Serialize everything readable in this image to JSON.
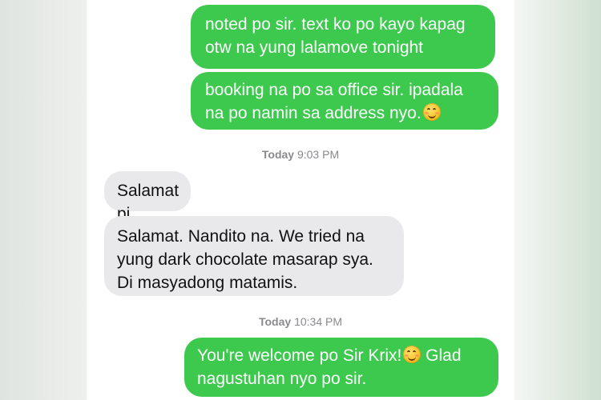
{
  "conversation": {
    "messages": [
      {
        "direction": "sent",
        "text": "noted po sir. text ko po kayo kapag\notw na yung lalamove tonight"
      },
      {
        "direction": "sent",
        "text": "booking na po sa office sir. ipadala\nna po namin sa address nyo.",
        "emoji": "smiling-face-icon"
      },
      {
        "direction": "received",
        "text": "Salamat pi"
      },
      {
        "direction": "received",
        "text": "Salamat. Nandito na. We tried na\nyung dark chocolate masarap sya.\nDi masyadong matamis."
      },
      {
        "direction": "sent",
        "text_before_emoji": "You're welcome po Sir Krix!",
        "emoji": "smiling-face-icon",
        "text_after_emoji": " Glad\nnagustuhan nyo po sir."
      }
    ],
    "timestamps": [
      {
        "day": "Today",
        "time": "9:03 PM"
      },
      {
        "day": "Today",
        "time": "10:34 PM"
      }
    ]
  },
  "colors": {
    "sent_bubble": "#3cc94e",
    "received_bubble": "#e9e9eb",
    "timestamp_text": "#8a8a8e"
  }
}
